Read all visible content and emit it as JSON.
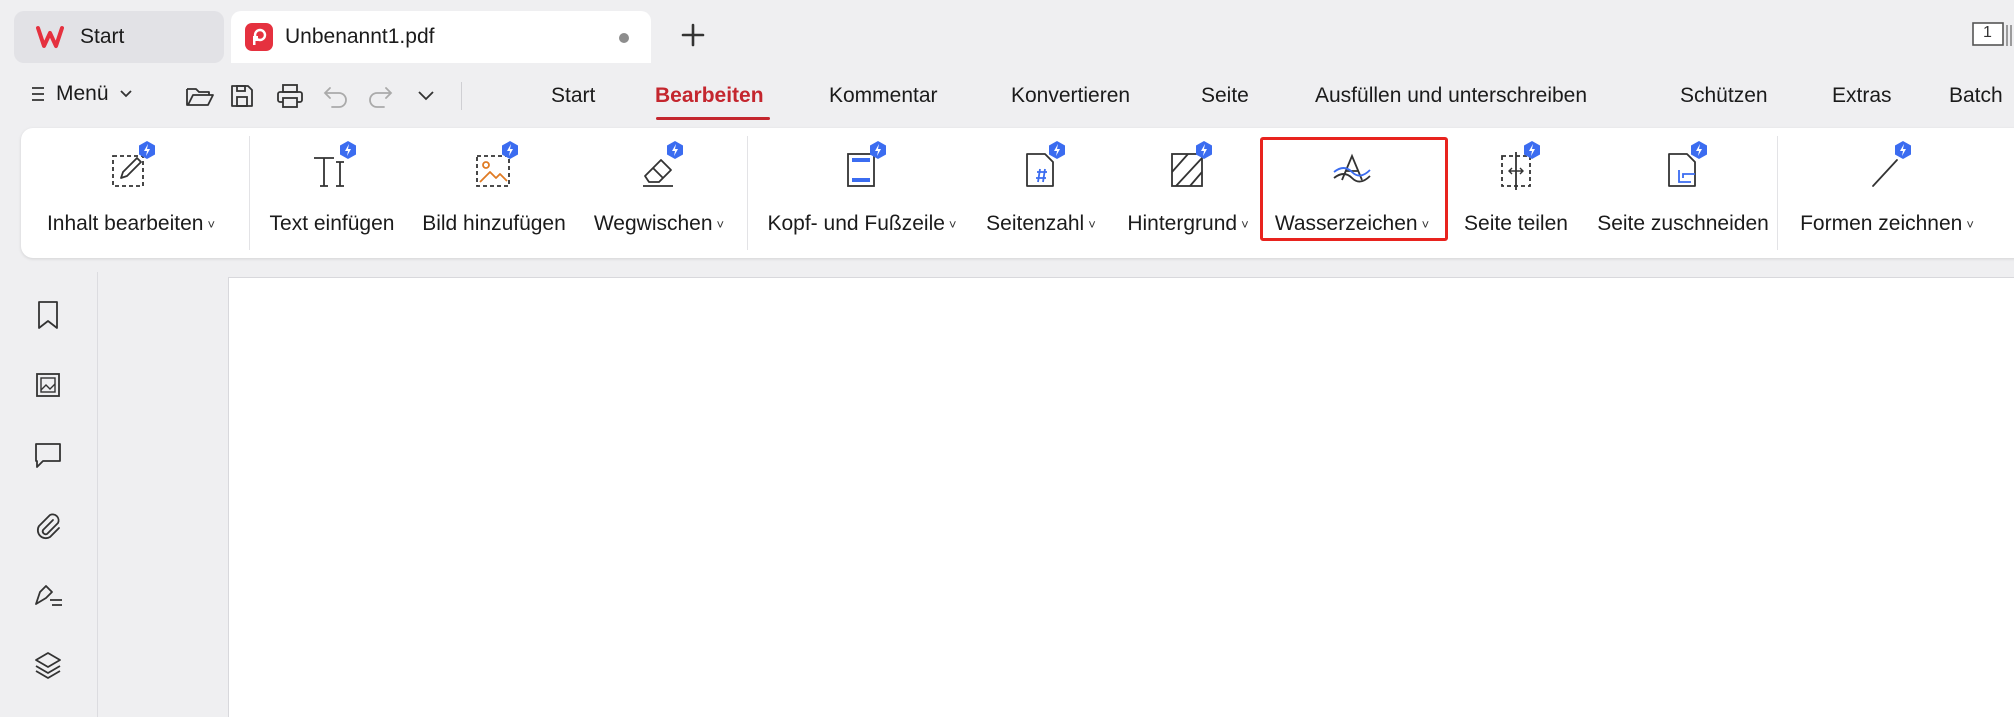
{
  "tabs": [
    {
      "label": "Start",
      "icon": "wps-logo-icon"
    },
    {
      "label": "Unbenannt1.pdf",
      "icon": "pdf-logo-icon",
      "unsaved": true
    }
  ],
  "page_counter": "1",
  "menu": {
    "label": "Menü"
  },
  "quick_access": [
    "open-folder-icon",
    "save-icon",
    "print-icon",
    "undo-icon",
    "redo-icon",
    "chevron-down-icon"
  ],
  "ribbon_tabs": [
    {
      "label": "Start"
    },
    {
      "label": "Bearbeiten",
      "active": true
    },
    {
      "label": "Kommentar"
    },
    {
      "label": "Konvertieren"
    },
    {
      "label": "Seite"
    },
    {
      "label": "Ausfüllen und unterschreiben"
    },
    {
      "label": "Schützen"
    },
    {
      "label": "Extras"
    },
    {
      "label": "Batch"
    }
  ],
  "ribbon": {
    "buttons": [
      {
        "label": "Inhalt bearbeiten",
        "dropdown": true,
        "icon": "edit-content-icon"
      },
      {
        "label": "Text einfügen",
        "icon": "insert-text-icon"
      },
      {
        "label": "Bild hinzufügen",
        "icon": "add-image-icon"
      },
      {
        "label": "Wegwischen",
        "dropdown": true,
        "icon": "eraser-icon"
      },
      {
        "label": "Kopf- und Fußzeile",
        "dropdown": true,
        "icon": "header-footer-icon"
      },
      {
        "label": "Seitenzahl",
        "dropdown": true,
        "icon": "page-number-icon"
      },
      {
        "label": "Hintergrund",
        "dropdown": true,
        "icon": "background-icon"
      },
      {
        "label": "Wasserzeichen",
        "dropdown": true,
        "icon": "watermark-icon",
        "highlighted": true
      },
      {
        "label": "Seite teilen",
        "icon": "split-page-icon"
      },
      {
        "label": "Seite zuschneiden",
        "icon": "crop-page-icon"
      },
      {
        "label": "Formen zeichnen",
        "dropdown": true,
        "icon": "draw-shapes-icon"
      }
    ]
  },
  "sidebar": [
    "bookmark-icon",
    "thumbnail-icon",
    "comment-icon",
    "attachment-icon",
    "signature-icon",
    "layers-icon"
  ],
  "colors": {
    "accent": "#c4262e",
    "highlight": "#e8231e",
    "badge": "#3b6cf0"
  }
}
